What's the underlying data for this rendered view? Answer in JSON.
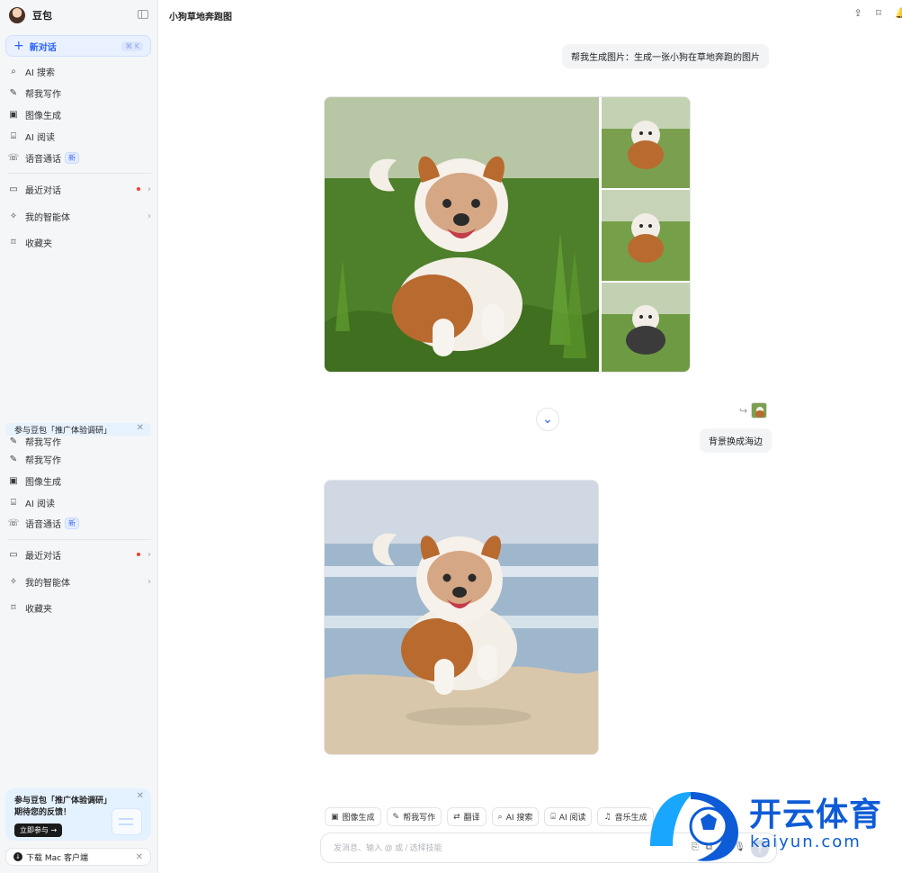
{
  "app": {
    "name": "豆包"
  },
  "sidebar": {
    "new_chat_label": "新对话",
    "new_chat_shortcut": "⌘ K",
    "items_top": [
      {
        "label": "AI 搜索",
        "icon": "search-icon"
      },
      {
        "label": "帮我写作",
        "icon": "pen-icon"
      },
      {
        "label": "图像生成",
        "icon": "image-icon"
      },
      {
        "label": "AI 阅读",
        "icon": "book-icon"
      },
      {
        "label": "语音通话",
        "icon": "phone-icon",
        "badge": "新"
      }
    ],
    "items_mid": [
      {
        "label": "最近对话",
        "icon": "chat-icon"
      },
      {
        "label": "我的智能体",
        "icon": "agent-icon"
      },
      {
        "label": "收藏夹",
        "icon": "bookmark-icon"
      }
    ],
    "promo_bar_text": "参与豆包「推广体验调研」",
    "items_top_dup": [
      {
        "label": "帮我写作",
        "icon": "pen-icon"
      },
      {
        "label": "帮我写作",
        "icon": "pen-icon"
      },
      {
        "label": "图像生成",
        "icon": "image-icon"
      },
      {
        "label": "AI 阅读",
        "icon": "book-icon"
      },
      {
        "label": "语音通话",
        "icon": "phone-icon",
        "badge": "新"
      }
    ],
    "items_mid_dup": [
      {
        "label": "最近对话",
        "icon": "chat-icon"
      },
      {
        "label": "我的智能体",
        "icon": "agent-icon"
      },
      {
        "label": "收藏夹",
        "icon": "bookmark-icon"
      }
    ],
    "promo_card": {
      "line1": "参与豆包「推广体验调研」",
      "line2": "期待您的反馈！",
      "cta": "立即参与 →"
    },
    "download_label": "下载 Mac 客户端"
  },
  "header": {
    "title": "小狗草地奔跑图"
  },
  "conversation": {
    "user_prompt_1": "帮我生成图片：生成一张小狗在草地奔跑的图片",
    "user_prompt_2": "背景换成海边"
  },
  "quick_actions": [
    {
      "label": "图像生成",
      "icon": "image-icon"
    },
    {
      "label": "帮我写作",
      "icon": "pen-icon"
    },
    {
      "label": "翻译",
      "icon": "translate-icon"
    },
    {
      "label": "AI 搜索",
      "icon": "search-icon"
    },
    {
      "label": "AI 阅读",
      "icon": "book-icon"
    },
    {
      "label": "音乐生成",
      "icon": "music-icon"
    }
  ],
  "composer": {
    "placeholder": "发消息、输入 @ 或 / 选择技能"
  },
  "watermark": {
    "zh": "开云体育",
    "en": "kaiyun.com"
  },
  "colors": {
    "accent": "#2a62ff",
    "sidebar_bg": "#f4f6f8",
    "bubble_bg": "#f3f4f6",
    "watermark": "#0d5bd6"
  }
}
